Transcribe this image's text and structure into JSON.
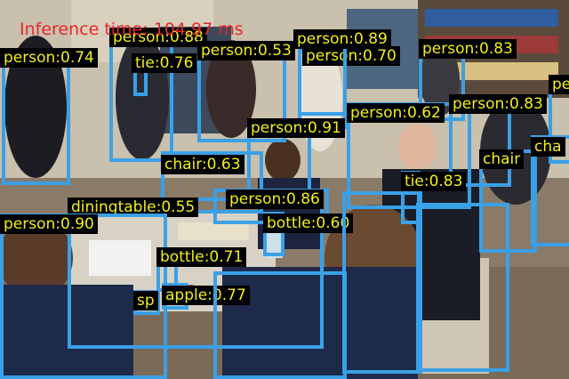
{
  "inference": {
    "text": "Inference time: 104.97 ms",
    "color": "#e8262a"
  },
  "colors": {
    "box": "#3aa0e8",
    "label_bg": "#000000",
    "label_text": "#f2ee1c"
  },
  "detections": [
    {
      "label": "person:0.74"
    },
    {
      "label": "person:0.88"
    },
    {
      "label": "tie:0.76"
    },
    {
      "label": "person:0.53"
    },
    {
      "label": "person:0.70"
    },
    {
      "label": "person:0.89"
    },
    {
      "label": "person:0.83"
    },
    {
      "label": "person:0.91"
    },
    {
      "label": "person:0.62"
    },
    {
      "label": "person:0.83"
    },
    {
      "label": "person"
    },
    {
      "label": "chair:0.63"
    },
    {
      "label": "chair"
    },
    {
      "label": "cha"
    },
    {
      "label": "tie:0.83"
    },
    {
      "label": "diningtable:0.55"
    },
    {
      "label": "person:0.86"
    },
    {
      "label": "bottle:0.60"
    },
    {
      "label": "person:0.90"
    },
    {
      "label": "bottle:0.71"
    },
    {
      "label": "apple:0.77"
    },
    {
      "label": "sp"
    }
  ]
}
